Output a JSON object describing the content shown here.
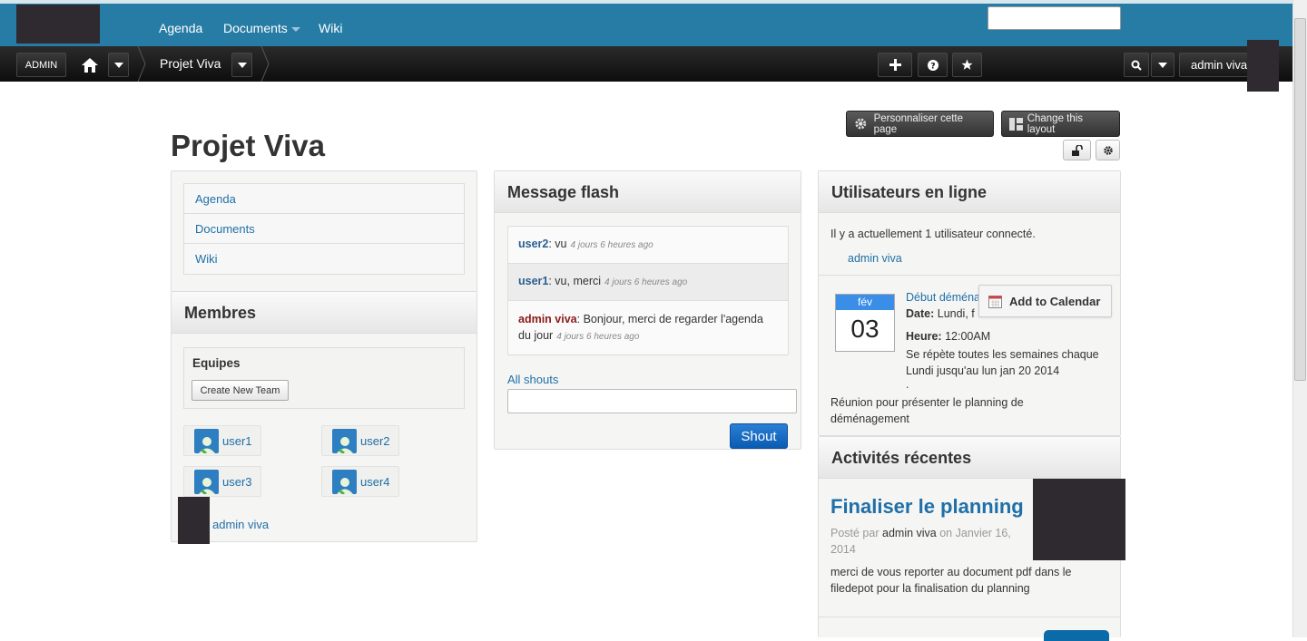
{
  "topnav": {
    "agenda": "Agenda",
    "documents": "Documents",
    "wiki": "Wiki"
  },
  "toolbar": {
    "admin": "ADMIN",
    "project": "Projet Viva",
    "user": "admin viva"
  },
  "page": {
    "title": "Projet Viva",
    "customize_btn": "Personnaliser cette page",
    "layout_btn": "Change this layout"
  },
  "left": {
    "nav": [
      "Agenda",
      "Documents",
      "Wiki"
    ],
    "members_title": "Membres",
    "teams_label": "Equipes",
    "create_team": "Create New Team",
    "members": [
      "user1",
      "user2",
      "user3",
      "user4"
    ],
    "admin": "admin viva"
  },
  "flash": {
    "title": "Message flash",
    "shouts": [
      {
        "user": "user2",
        "text": ": vu",
        "time": "4 jours 6 heures ago"
      },
      {
        "user": "user1",
        "text": ": vu, merci",
        "time": "4 jours 6 heures ago"
      },
      {
        "user": "admin viva",
        "text": ": Bonjour, merci de regarder l'agenda du jour",
        "time": "4 jours 6 heures ago"
      }
    ],
    "all_shouts": "All shouts",
    "shout_btn": "Shout"
  },
  "online": {
    "title": "Utilisateurs en ligne",
    "text": "Il y a actuellement 1 utilisateur connecté.",
    "user": "admin viva"
  },
  "event": {
    "month": "fév",
    "day": "03",
    "title": "Début déména",
    "date_label": "Date:",
    "date_value": "Lundi, f",
    "time_label": "Heure:",
    "time_value": "12:00AM",
    "repeat": "Se répète toutes les semaines chaque Lundi jusqu'au lun jan 20 2014",
    "dot": ".",
    "desc": "Réunion pour présenter le planning de déménagement",
    "add_cal": "Add to Calendar"
  },
  "recent": {
    "title": "Activités récentes",
    "headline": "Finaliser le planning",
    "posted_by": "Posté par",
    "author": "admin viva",
    "on_date": "on Janvier 16, 2014",
    "body": "merci de vous reporter au document pdf dans le filedepot pour la finalisation du planning"
  },
  "colors": {
    "topbar": "#267ca4",
    "link": "#1f6fa8",
    "toolbar": "#111111"
  }
}
